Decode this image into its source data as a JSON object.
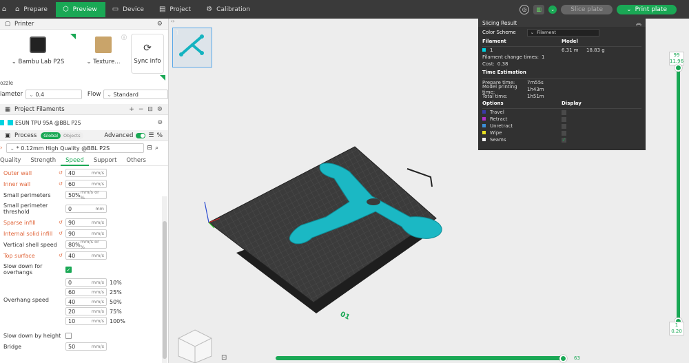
{
  "topbar": {
    "tabs": [
      {
        "label": "Prepare",
        "icon": "home-icon"
      },
      {
        "label": "Preview",
        "icon": "cube-icon",
        "active": true
      },
      {
        "label": "Device",
        "icon": "device-icon"
      },
      {
        "label": "Project",
        "icon": "project-icon"
      },
      {
        "label": "Calibration",
        "icon": "calibration-icon"
      }
    ],
    "slice_label": "Slice plate",
    "print_label": "Print plate"
  },
  "printer": {
    "section_title": "Printer",
    "printer_name": "Bambu Lab P2S",
    "plate_name": "Texture...",
    "sync_label": "Sync info",
    "nozzle_label": "ozzle",
    "diameter_label": "iameter",
    "diameter_value": "0.4",
    "flow_label": "Flow",
    "flow_value": "Standard"
  },
  "filaments": {
    "section_title": "Project Filaments",
    "item": "ESUN TPU 95A @BBL P2S",
    "color": "#00d3e0"
  },
  "process": {
    "section_title": "Process",
    "global_label": "Global",
    "objects_label": "Objects",
    "advanced_label": "Advanced",
    "preset": "* 0.12mm High Quality @BBL P2S",
    "tabs": [
      "Quality",
      "Strength",
      "Speed",
      "Support",
      "Others"
    ],
    "active_tab": "Speed"
  },
  "params": [
    {
      "label": "Outer wall",
      "value": "40",
      "unit": "mm/s",
      "modified": true
    },
    {
      "label": "Inner wall",
      "value": "60",
      "unit": "mm/s",
      "modified": true
    },
    {
      "label": "Small perimeters",
      "value": "50%",
      "unit": "mm/s or %",
      "modified": false
    },
    {
      "label": "Small perimeter threshold",
      "value": "0",
      "unit": "mm",
      "modified": false
    },
    {
      "label": "Sparse infill",
      "value": "90",
      "unit": "mm/s",
      "modified": true
    },
    {
      "label": "Internal solid infill",
      "value": "90",
      "unit": "mm/s",
      "modified": true
    },
    {
      "label": "Vertical shell speed",
      "value": "80%",
      "unit": "mm/s or %",
      "modified": false
    },
    {
      "label": "Top surface",
      "value": "40",
      "unit": "mm/s",
      "modified": true
    }
  ],
  "slow_down_overhangs": {
    "label": "Slow down for overhangs",
    "checked": true
  },
  "overhang": {
    "label": "Overhang speed",
    "rows": [
      {
        "value": "0",
        "unit": "mm/s",
        "pct": "10%"
      },
      {
        "value": "60",
        "unit": "mm/s",
        "pct": "25%"
      },
      {
        "value": "40",
        "unit": "mm/s",
        "pct": "50%"
      },
      {
        "value": "20",
        "unit": "mm/s",
        "pct": "75%"
      },
      {
        "value": "10",
        "unit": "mm/s",
        "pct": "100%"
      }
    ]
  },
  "slow_down_height": {
    "label": "Slow down by height",
    "checked": false
  },
  "bridge": {
    "label": "Bridge",
    "value": "50",
    "unit": "mm/s"
  },
  "slicing_result": {
    "title": "Slicing Result",
    "color_scheme_label": "Color Scheme",
    "color_scheme_value": "Filament",
    "col_filament": "Filament",
    "col_model": "Model",
    "filament_id": "1",
    "filament_length": "6.31 m",
    "filament_weight": "18.83 g",
    "change_times_label": "Filament change times:",
    "change_times": "1",
    "cost_label": "Cost:",
    "cost": "0.38",
    "time_title": "Time Estimation",
    "prepare_label": "Prepare time:",
    "prepare_time": "7m55s",
    "model_time_label": "Model printing time:",
    "model_time": "1h43m",
    "total_label": "Total time:",
    "total_time": "1h51m",
    "options_label": "Options",
    "display_label": "Display",
    "options": [
      {
        "label": "Travel",
        "color": "#3a3aa8",
        "checked": false
      },
      {
        "label": "Retract",
        "color": "#b030c8",
        "checked": false
      },
      {
        "label": "Unretract",
        "color": "#3b8fd8",
        "checked": false
      },
      {
        "label": "Wipe",
        "color": "#e8e020",
        "checked": false
      },
      {
        "label": "Seams",
        "color": "#f0f0f0",
        "checked": true
      }
    ]
  },
  "layer_slider": {
    "top_layer": "99",
    "top_height": "11.96",
    "bottom_layer": "1",
    "bottom_height": "0.20"
  },
  "move_slider": {
    "value": "63"
  },
  "plate_number": "01",
  "thumbnail_number": "1",
  "colors": {
    "accent": "#1aa855",
    "filament": "#00d3e0",
    "modified": "#e0653a"
  }
}
